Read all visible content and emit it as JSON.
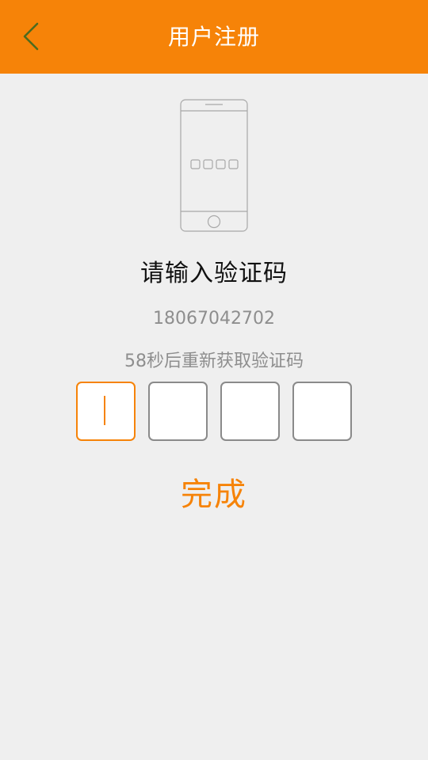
{
  "header": {
    "title": "用户注册",
    "back_icon": "chevron-left-icon"
  },
  "illustration": {
    "icon": "phone-code-illustration"
  },
  "main": {
    "heading": "请输入验证码",
    "phone_number": "18067042702",
    "countdown": "58秒后重新获取验证码",
    "code_inputs": [
      "",
      "",
      "",
      ""
    ],
    "done_label": "完成"
  },
  "colors": {
    "accent": "#f68308",
    "background": "#efefef",
    "muted_text": "#8e8e8e",
    "box_border": "#8a8a8a"
  }
}
